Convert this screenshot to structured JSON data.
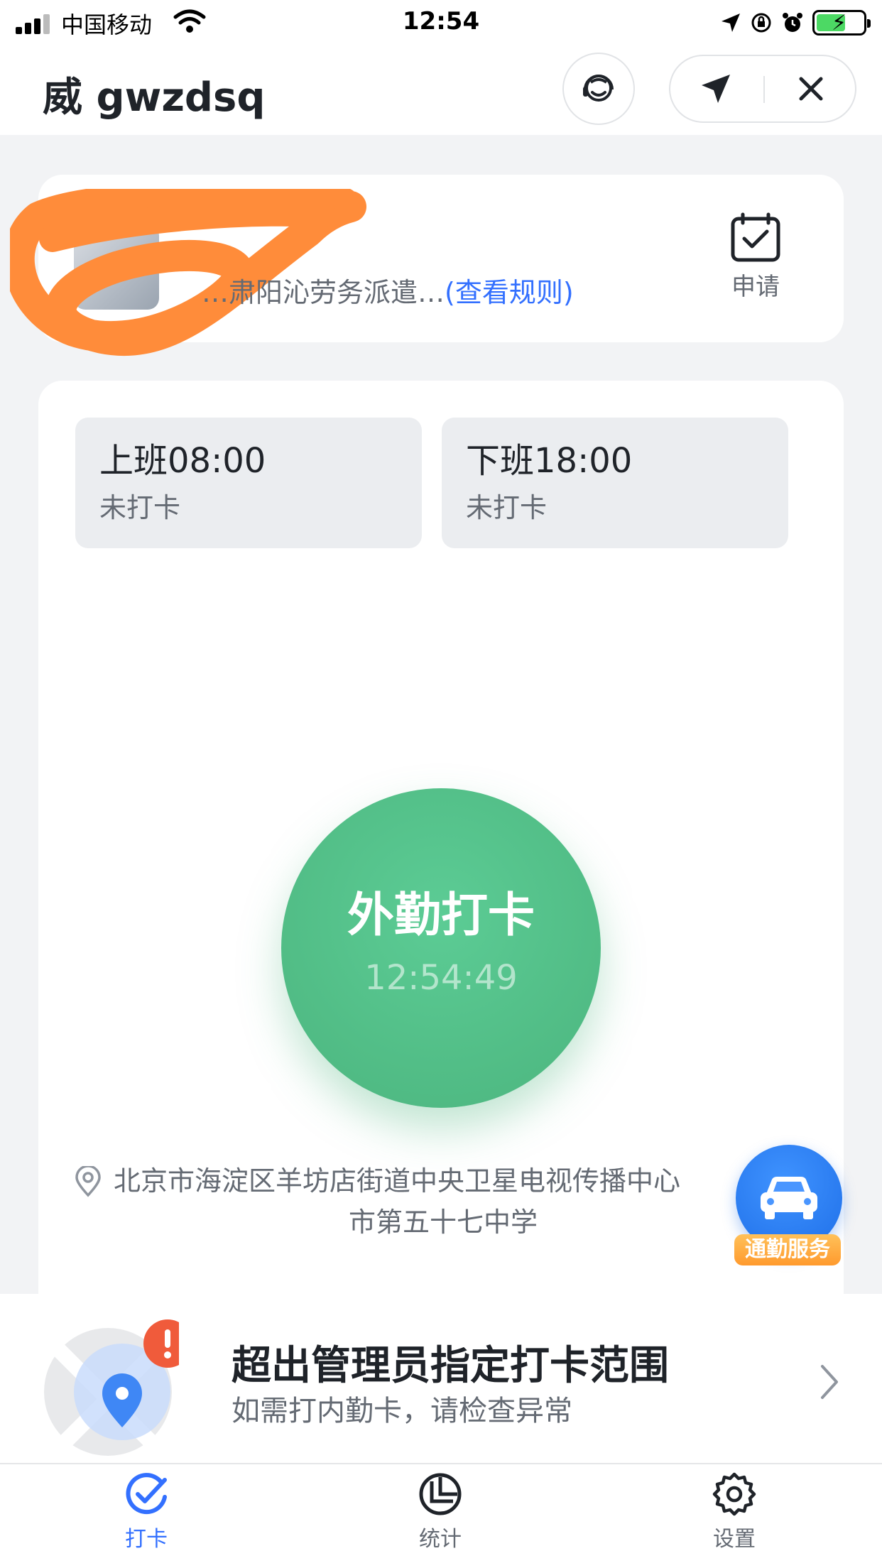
{
  "status_bar": {
    "carrier": "中国移动",
    "time": "12:54"
  },
  "header": {
    "title": "威 gwzdsq",
    "icons": [
      "support-agent-icon",
      "navigate-arrow-icon",
      "close-icon"
    ]
  },
  "profile": {
    "company": "…肃阳沁劳务派遣…",
    "rules_link": "(查看规则)",
    "apply_label": "申请"
  },
  "shifts": [
    {
      "title": "上班08:00",
      "status": "未打卡"
    },
    {
      "title": "下班18:00",
      "status": "未打卡"
    }
  ],
  "punch": {
    "label": "外勤打卡",
    "time": "12:54:49",
    "color": "#52be87"
  },
  "location": {
    "line1": "北京市海淀区羊坊店街道中央卫星电视传播中心",
    "line2": "市第五十七中学"
  },
  "commute": {
    "label": "通勤服务"
  },
  "warning": {
    "title": "超出管理员指定打卡范围",
    "description": "如需打内勤卡，请检查异常"
  },
  "tabs": [
    {
      "label": "打卡",
      "icon": "check-punch-icon",
      "active": true
    },
    {
      "label": "统计",
      "icon": "pie-stats-icon",
      "active": false
    },
    {
      "label": "设置",
      "icon": "gear-icon",
      "active": false
    }
  ],
  "colors": {
    "accent": "#3370ff",
    "punch_green": "#52be87",
    "warning_red": "#f05b3b",
    "commute_blue": "#2b7ef5",
    "commute_orange": "#ffa53b"
  }
}
